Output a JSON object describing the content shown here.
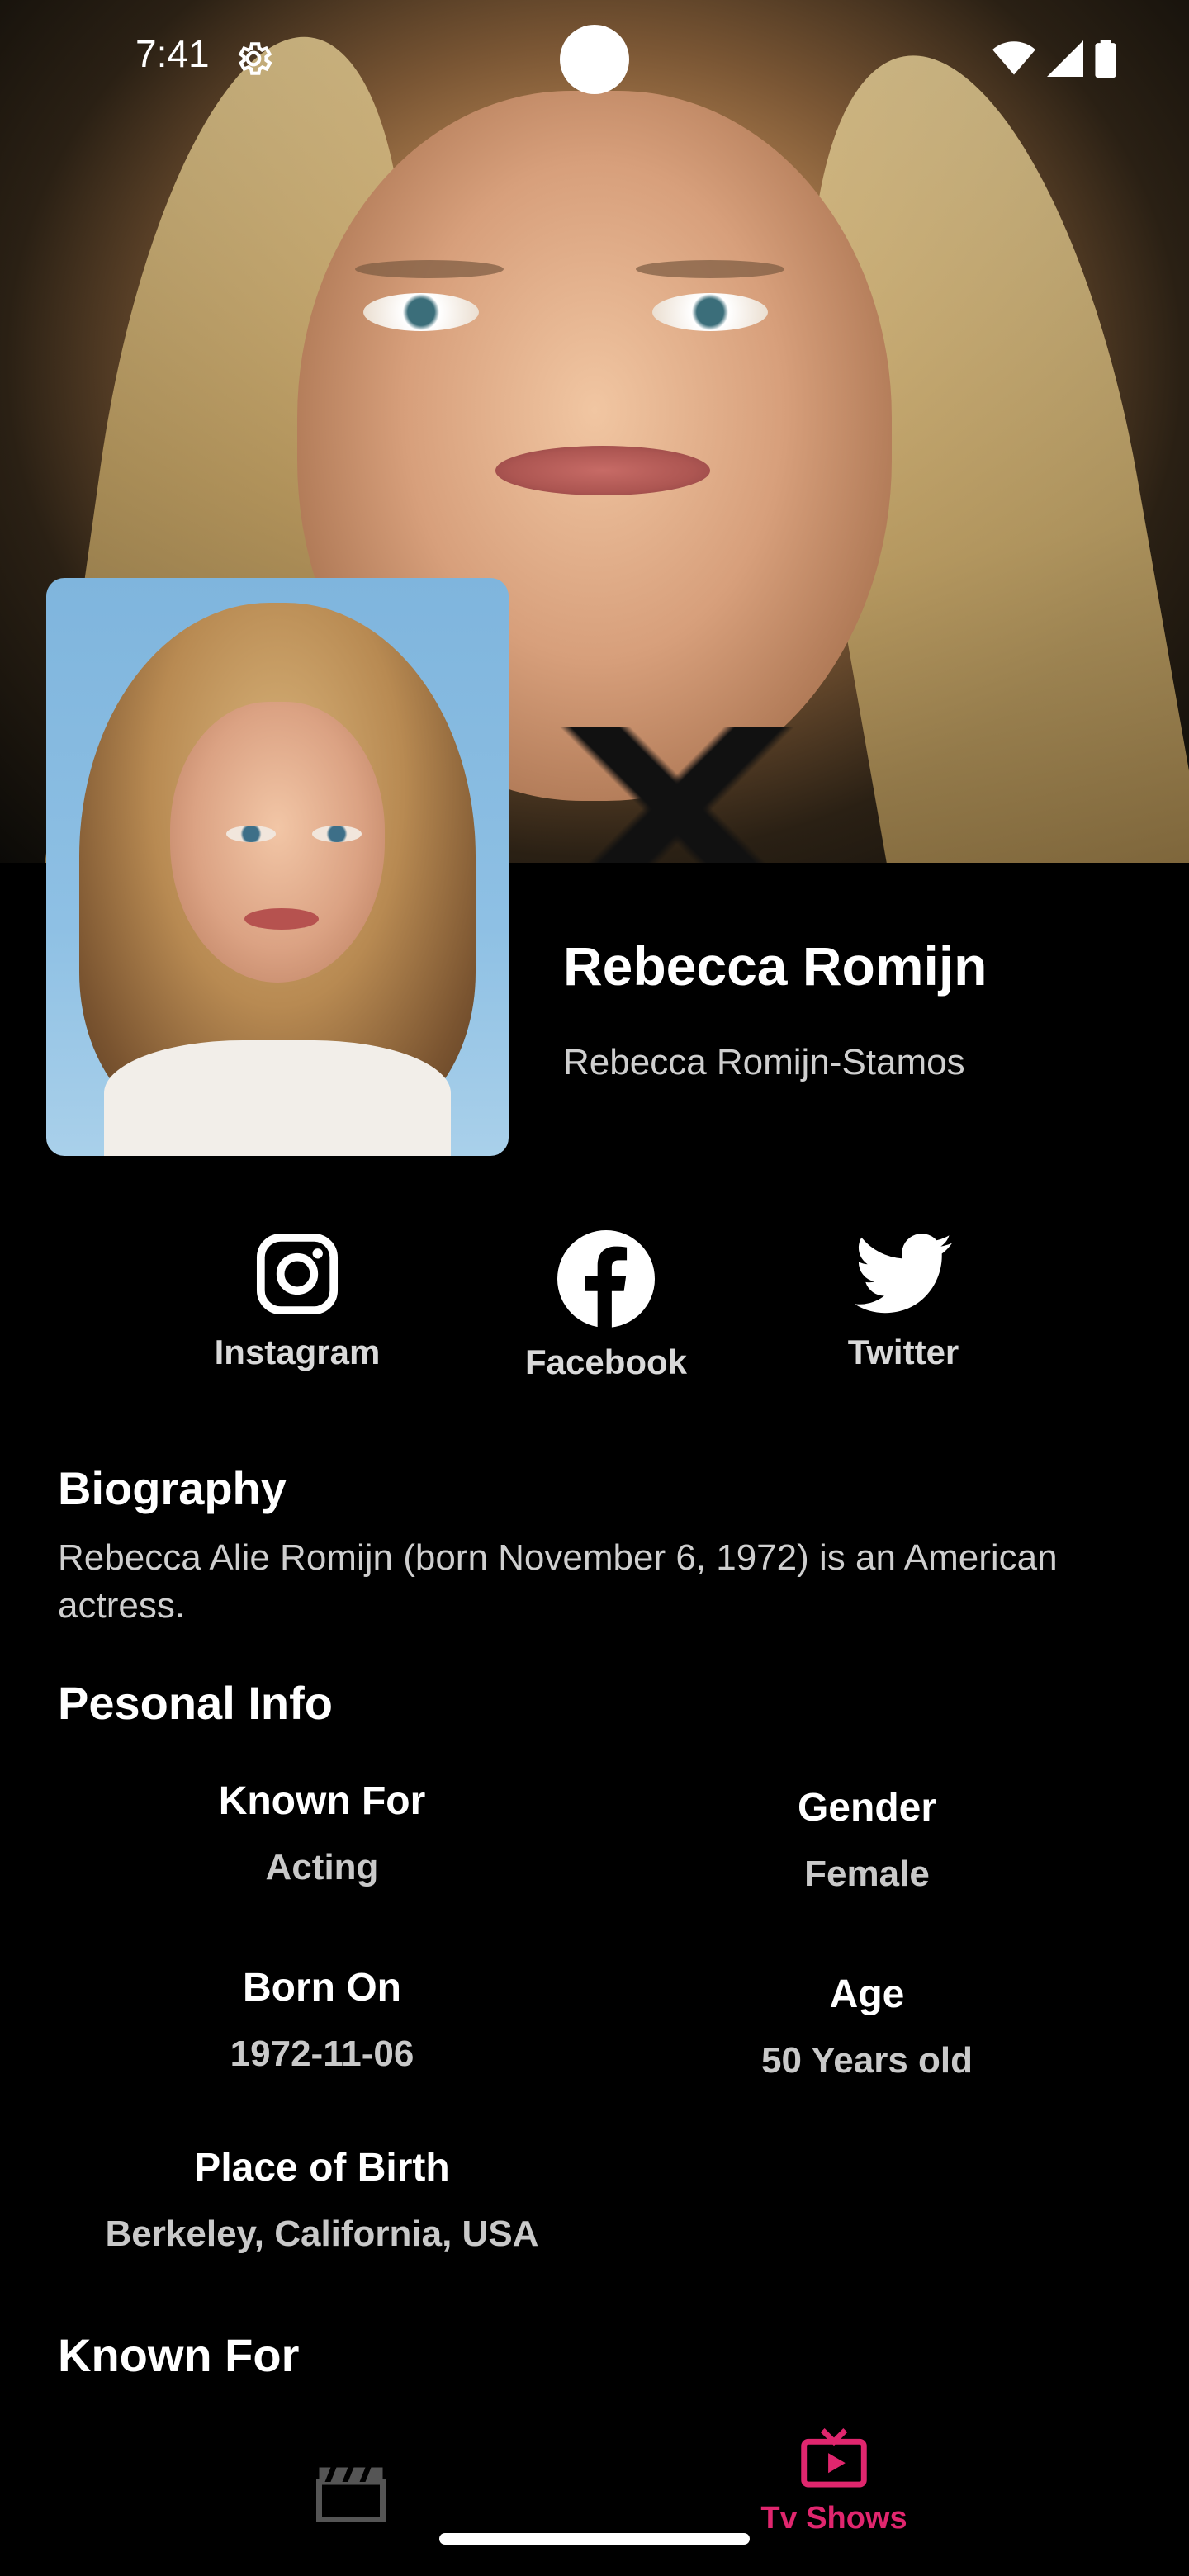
{
  "status_bar": {
    "time": "7:41"
  },
  "person": {
    "name": "Rebecca Romijn",
    "also_known_as": "Rebecca Romijn-Stamos"
  },
  "social": {
    "instagram": "Instagram",
    "facebook": "Facebook",
    "twitter": "Twitter"
  },
  "biography": {
    "title": "Biography",
    "text": "Rebecca Alie Romijn (born November 6, 1972) is an American actress."
  },
  "personal_info": {
    "title": "Pesonal Info",
    "known_for_label": "Known For",
    "known_for_value": "Acting",
    "gender_label": "Gender",
    "gender_value": "Female",
    "born_on_label": "Born On",
    "born_on_value": "1972-11-06",
    "age_label": "Age",
    "age_value": "50 Years old",
    "place_of_birth_label": "Place of Birth",
    "place_of_birth_value": "Berkeley, California, USA"
  },
  "known_for_section": {
    "title": "Known For"
  },
  "bottom_nav": {
    "movies_icon": "clapperboard-icon",
    "tv_label": "Tv Shows",
    "active_color": "#e0266e"
  }
}
